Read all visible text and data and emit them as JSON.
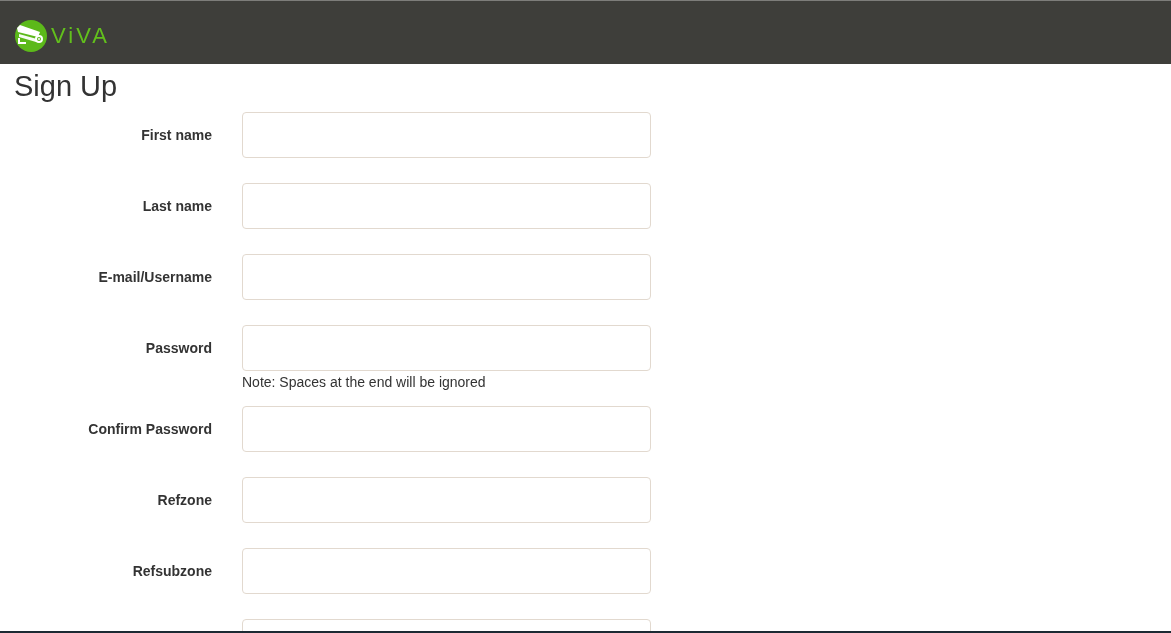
{
  "header": {
    "logo_text": "ViVA"
  },
  "title": "Sign Up",
  "form": {
    "fields": [
      {
        "kind": "text_input",
        "label": "First name"
      },
      {
        "kind": "text_input",
        "label": "Last name"
      },
      {
        "kind": "text_input",
        "label": "E-mail/Username"
      },
      {
        "kind": "text_input",
        "label": "Password",
        "note": "Note: Spaces at the end will be ignored"
      },
      {
        "kind": "text_input",
        "label": "Confirm Password"
      },
      {
        "kind": "text_input",
        "label": "Refzone"
      },
      {
        "kind": "text_input",
        "label": "Refsubzone"
      },
      {
        "kind": "text_input"
      }
    ]
  }
}
